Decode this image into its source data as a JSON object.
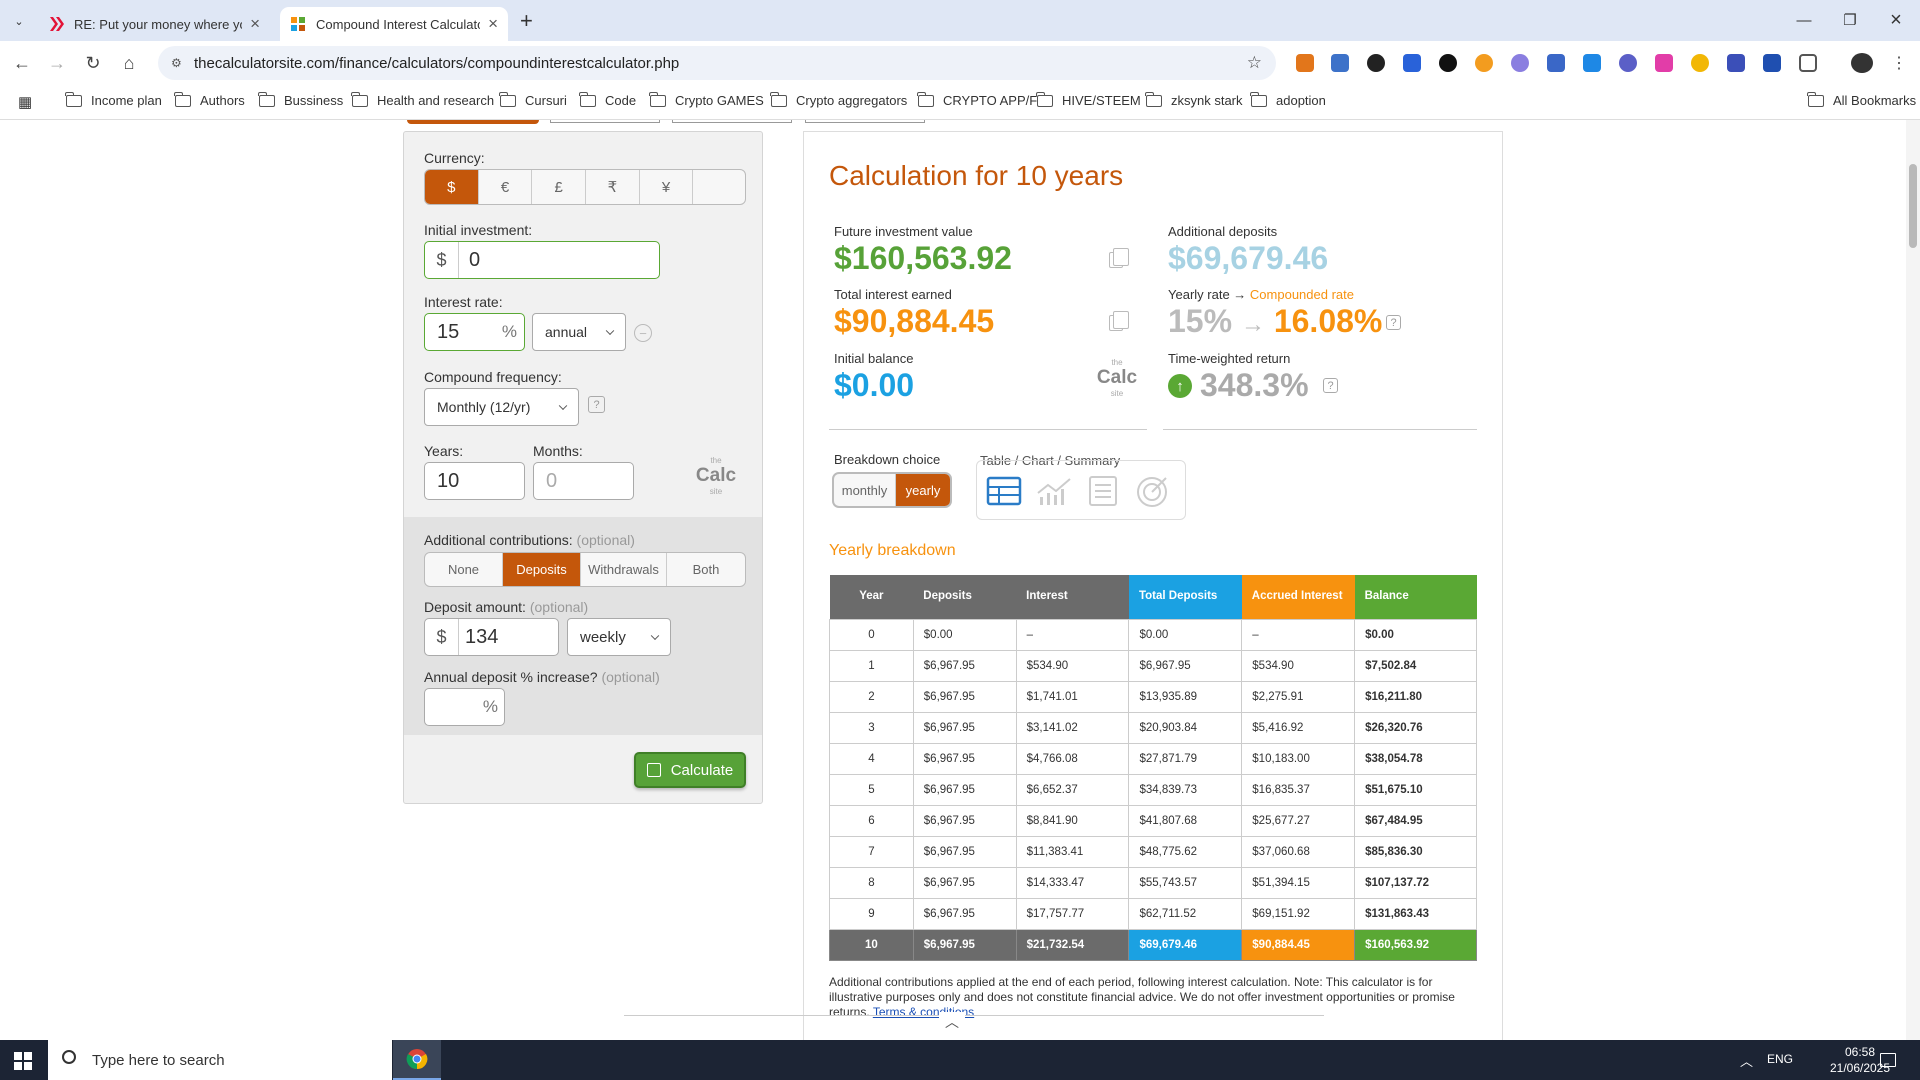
{
  "browser": {
    "tabs": [
      {
        "title": "RE: Put your money where your",
        "active": false
      },
      {
        "title": "Compound Interest Calculator",
        "active": true
      }
    ],
    "url": "thecalculatorsite.com/finance/calculators/compoundinterestcalculator.php",
    "bookmarks": [
      "Income plan",
      "Authors",
      "Bussiness",
      "Health and research",
      "Cursuri",
      "Code",
      "Crypto GAMES",
      "Crypto aggregators",
      "CRYPTO APP/F",
      "HIVE/STEEM",
      "zksynk stark",
      "adoption"
    ],
    "all_bookmarks": "All Bookmarks"
  },
  "form": {
    "currency_label": "Currency:",
    "currencies": [
      "$",
      "€",
      "£",
      "₹",
      "¥",
      ""
    ],
    "initial_label": "Initial investment:",
    "currency_symbol": "$",
    "initial_value": "0",
    "rate_label": "Interest rate:",
    "rate_value": "15",
    "pct": "%",
    "rate_period": "annual",
    "compound_label": "Compound frequency:",
    "compound_value": "Monthly (12/yr)",
    "help": "?",
    "years_label": "Years:",
    "years_value": "10",
    "months_label": "Months:",
    "months_placeholder": "0",
    "addcontrib_label": "Additional contributions:",
    "optional": "(optional)",
    "contrib_options": [
      "None",
      "Deposits",
      "Withdrawals",
      "Both"
    ],
    "deposit_label": "Deposit amount:",
    "deposit_value": "134",
    "deposit_period": "weekly",
    "increase_label": "Annual deposit % increase?",
    "calculate": "Calculate",
    "logo_text": "Calc",
    "logo_sub": "site",
    "logo_the": "the"
  },
  "results": {
    "title": "Calculation for 10 years",
    "future_label": "Future investment value",
    "future_value": "$160,563.92",
    "interest_label": "Total interest earned",
    "interest_value": "$90,884.45",
    "initial_label": "Initial balance",
    "initial_value": "$0.00",
    "deposits_label": "Additional deposits",
    "deposits_value": "$69,679.46",
    "yearly_rate_label": "Yearly rate →",
    "compounded_rate_label": "Compounded rate",
    "rate_from": "15%",
    "rate_arrow": "→",
    "rate_to": "16.08%",
    "twr_label": "Time-weighted return",
    "twr_value": "348.3%",
    "breakdown_label": "Breakdown choice",
    "breakdown_options": [
      "monthly",
      "yearly"
    ],
    "view_label": "Table / Chart / Summary",
    "yearly_heading": "Yearly breakdown"
  },
  "table": {
    "headers": [
      "Year",
      "Deposits",
      "Interest",
      "Total Deposits",
      "Accrued Interest",
      "Balance"
    ],
    "header_colors": [
      "#6b6b6b",
      "#6b6b6b",
      "#6b6b6b",
      "#1ba1e2",
      "#f7920f",
      "#5aa834"
    ],
    "rows": [
      [
        "0",
        "$0.00",
        "–",
        "$0.00",
        "–",
        "$0.00"
      ],
      [
        "1",
        "$6,967.95",
        "$534.90",
        "$6,967.95",
        "$534.90",
        "$7,502.84"
      ],
      [
        "2",
        "$6,967.95",
        "$1,741.01",
        "$13,935.89",
        "$2,275.91",
        "$16,211.80"
      ],
      [
        "3",
        "$6,967.95",
        "$3,141.02",
        "$20,903.84",
        "$5,416.92",
        "$26,320.76"
      ],
      [
        "4",
        "$6,967.95",
        "$4,766.08",
        "$27,871.79",
        "$10,183.00",
        "$38,054.78"
      ],
      [
        "5",
        "$6,967.95",
        "$6,652.37",
        "$34,839.73",
        "$16,835.37",
        "$51,675.10"
      ],
      [
        "6",
        "$6,967.95",
        "$8,841.90",
        "$41,807.68",
        "$25,677.27",
        "$67,484.95"
      ],
      [
        "7",
        "$6,967.95",
        "$11,383.41",
        "$48,775.62",
        "$37,060.68",
        "$85,836.30"
      ],
      [
        "8",
        "$6,967.95",
        "$14,333.47",
        "$55,743.57",
        "$51,394.15",
        "$107,137.72"
      ],
      [
        "9",
        "$6,967.95",
        "$17,757.77",
        "$62,711.52",
        "$69,151.92",
        "$131,863.43"
      ]
    ],
    "total": [
      "10",
      "$6,967.95",
      "$21,732.54",
      "$69,679.46",
      "$90,884.45",
      "$160,563.92"
    ],
    "total_colors": [
      "#6b6b6b",
      "#6b6b6b",
      "#6b6b6b",
      "#1ba1e2",
      "#f7920f",
      "#5aa834"
    ]
  },
  "note": {
    "text": "Additional contributions applied at the end of each period, following interest calculation. Note: This calculator is for illustrative purposes only and does not constitute financial advice. We do not offer investment opportunities or promise returns.",
    "link": "Terms & conditions"
  },
  "taskbar": {
    "search_placeholder": "Type here to search",
    "lang": "ENG",
    "time": "06:58",
    "date": "21/06/2025"
  },
  "colors": {
    "accent": "#c4570b",
    "green": "#57a238",
    "blue": "#1ba1e2",
    "orange": "#f7920f"
  }
}
